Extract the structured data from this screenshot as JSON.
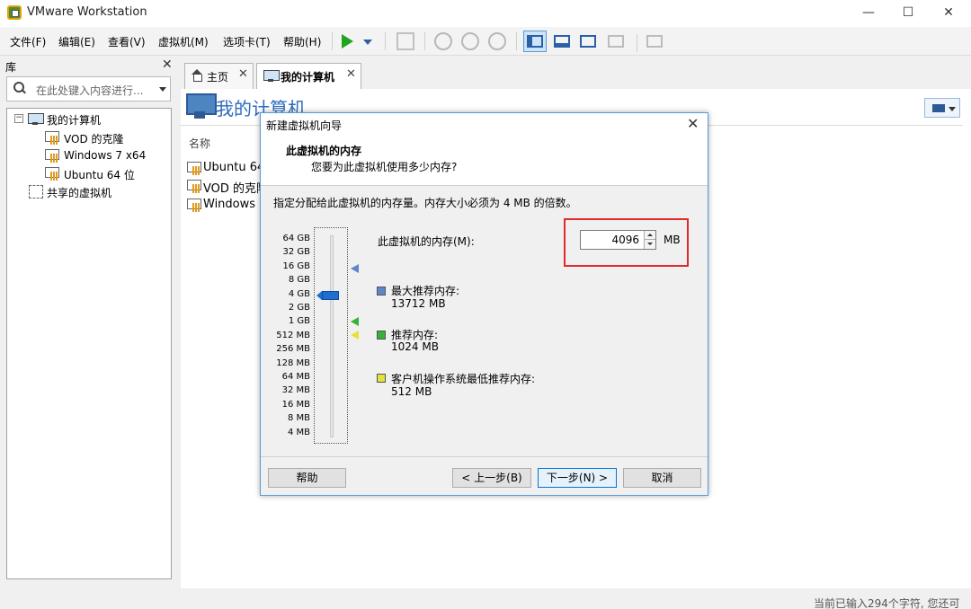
{
  "window": {
    "title": "VMware Workstation",
    "minimize": "—",
    "maximize": "☐",
    "close": "✕"
  },
  "menu": [
    "文件(F)",
    "编辑(E)",
    "查看(V)",
    "虚拟机(M)",
    "选项卡(T)",
    "帮助(H)"
  ],
  "library": {
    "title": "库",
    "close": "✕",
    "search_placeholder": "在此处键入内容进行...",
    "tree": {
      "root": "我的计算机",
      "children": [
        "VOD 的克隆",
        "Windows 7 x64",
        "Ubuntu 64 位"
      ],
      "shared": "共享的虚拟机"
    }
  },
  "tabs": [
    {
      "label": "主页",
      "close": "✕"
    },
    {
      "label": "我的计算机",
      "close": "✕"
    }
  ],
  "content": {
    "title": "我的计算机",
    "column_name": "名称",
    "items": [
      "Ubuntu 64",
      "VOD 的克隆",
      "Windows 7"
    ],
    "status_partial": "当前已输入294个字符, 您还可"
  },
  "dialog": {
    "title": "新建虚拟机向导",
    "close": "✕",
    "header_title": "此虚拟机的内存",
    "header_subtitle": "您要为此虚拟机使用多少内存?",
    "instruction": "指定分配给此虚拟机的内存量。内存大小必须为 4 MB 的倍数。",
    "memory_label": "此虚拟机的内存(M):",
    "memory_value": "4096",
    "memory_unit": "MB",
    "scale_labels": [
      "64 GB",
      "32 GB",
      "16 GB",
      "8 GB",
      "4 GB",
      "2 GB",
      "1 GB",
      "512 MB",
      "256 MB",
      "128 MB",
      "64 MB",
      "32 MB",
      "16 MB",
      "8 MB",
      "4 MB"
    ],
    "legend": {
      "max": {
        "title": "最大推荐内存:",
        "value": "13712 MB",
        "color": "#5d87c8"
      },
      "recommended": {
        "title": "推荐内存:",
        "value": "1024 MB",
        "color": "#36b336"
      },
      "guest_min": {
        "title": "客户机操作系统最低推荐内存:",
        "value": "512 MB",
        "color": "#e4e23a"
      }
    },
    "buttons": {
      "help": "帮助",
      "back": "< 上一步(B)",
      "next": "下一步(N) >",
      "cancel": "取消"
    }
  },
  "colors": {
    "accent": "#0078d7",
    "highlight": "#e22a2a",
    "title_blue": "#2d6bbf"
  }
}
